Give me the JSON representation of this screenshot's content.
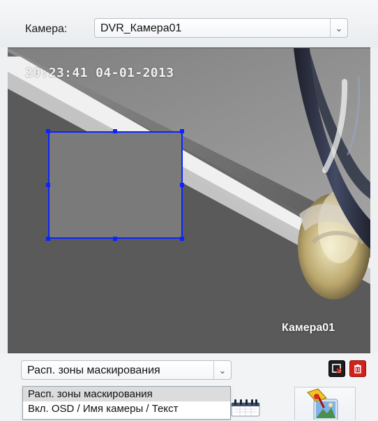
{
  "header": {
    "camera_label": "Камера:",
    "camera_select_value": "DVR_Камера01",
    "dropdown_arrow": "⌄"
  },
  "video": {
    "timestamp": "20:23:41 04-01-2013",
    "camera_overlay": "Камера01"
  },
  "mask_controls": {
    "selected_mode": "Расп. зоны маскирования",
    "dropdown_arrow": "⌄",
    "options": [
      {
        "label": "Расп. зоны маскирования",
        "selected": true
      },
      {
        "label": "Вкл. OSD / Имя камеры / Текст",
        "selected": false
      }
    ]
  },
  "colors": {
    "selection_border": "#0b23ff",
    "mask_fill": "#7a7a7a",
    "delete_red": "#d32018",
    "dark_button": "#1d1d1f"
  },
  "icons": {
    "camera_select_arrow": "chevron-down-icon",
    "mode_select_arrow": "chevron-down-icon",
    "delete_zone": "delete-zone-icon",
    "delete_all": "trash-icon",
    "calendar": "calendar-icon",
    "image": "image-pin-icon"
  }
}
